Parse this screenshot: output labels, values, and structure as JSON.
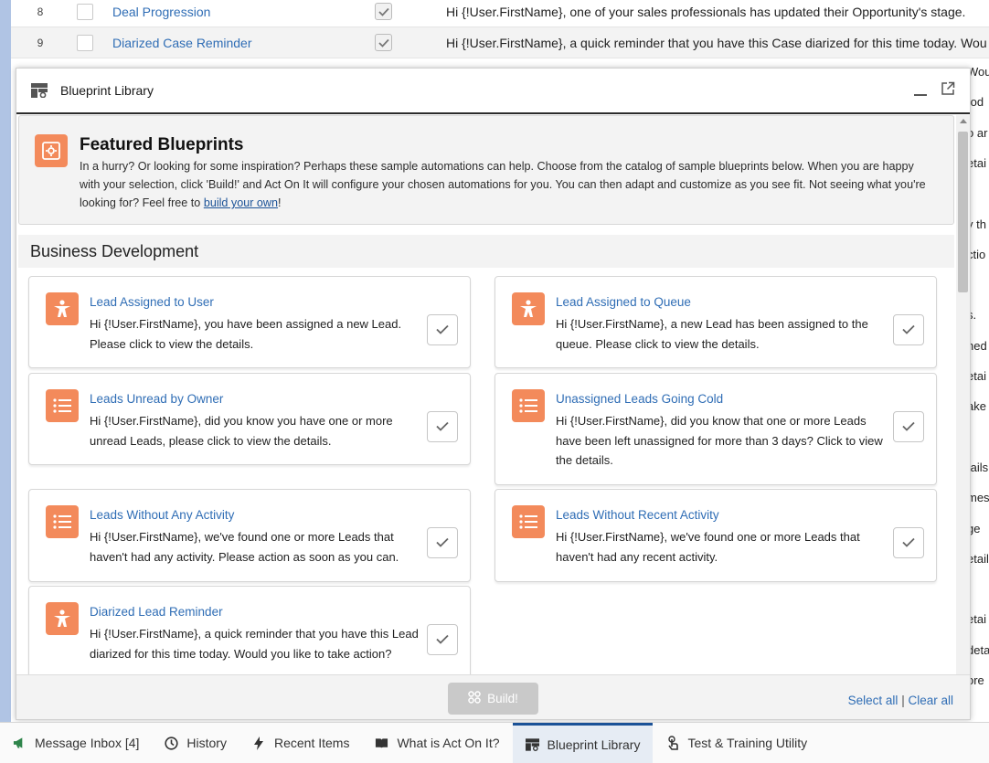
{
  "background_table": {
    "rows": [
      {
        "num": "8",
        "name": "Deal Progression",
        "message": "Hi {!User.FirstName}, one of your sales professionals has updated their Opportunity's stage."
      },
      {
        "num": "9",
        "name": "Diarized Case Reminder",
        "message": "Hi {!User.FirstName}, a quick reminder that you have this Case diarized for this time today. Wou"
      }
    ],
    "right_fragments": [
      "Wou",
      "tod",
      "o ar",
      "etai",
      "",
      "y th",
      "ctio",
      "",
      "s.",
      "ned",
      "etai",
      "ake",
      "",
      "tails",
      "mes",
      "ge",
      "etail",
      "",
      "etai",
      "deta",
      "ore"
    ]
  },
  "modal": {
    "title": "Blueprint Library",
    "featured": {
      "title": "Featured Blueprints",
      "description_before": "In a hurry? Or looking for some inspiration? Perhaps these sample automations can help. Choose from the catalog of sample blueprints below. When you are happy with your selection, click 'Build!' and Act On It will configure your chosen automations for you. You can then adapt and customize as you see fit. Not seeing what you're looking for? Feel free to ",
      "link_text": "build your own",
      "description_after": "!"
    },
    "section_title": "Business Development",
    "cards": [
      {
        "title": "Lead Assigned to User",
        "description": "Hi {!User.FirstName}, you have been assigned a new Lead. Please click to view the details.",
        "icon": "person-icon"
      },
      {
        "title": "Lead Assigned to Queue",
        "description": "Hi {!User.FirstName}, a new Lead has been assigned to the queue. Please click to view the details.",
        "icon": "person-icon"
      },
      {
        "title": "Leads Unread by Owner",
        "description": "Hi {!User.FirstName}, did you know you have one or more unread Leads, please click to view the details.",
        "icon": "list-icon"
      },
      {
        "title": "Unassigned Leads Going Cold",
        "description": "Hi {!User.FirstName}, did you know that one or more Leads have been left unassigned for more than 3 days? Click to view the details.",
        "icon": "list-icon"
      },
      {
        "title": "Leads Without Any Activity",
        "description": "Hi {!User.FirstName}, we've found one or more Leads that haven't had any activity. Please action as soon as you can.",
        "icon": "list-icon"
      },
      {
        "title": "Leads Without Recent Activity",
        "description": "Hi {!User.FirstName}, we've found one or more Leads that haven't had any recent activity.",
        "icon": "list-icon"
      },
      {
        "title": "Diarized Lead Reminder",
        "description": "Hi {!User.FirstName}, a quick reminder that you have this Lead diarized for this time today. Would you like to take action?",
        "icon": "person-icon"
      }
    ],
    "footer": {
      "build_label": "Build!",
      "select_all": "Select all",
      "separator": "|",
      "clear_all": "Clear all"
    }
  },
  "utility_bar": [
    {
      "label": "Message Inbox [4]",
      "icon": "megaphone-icon"
    },
    {
      "label": "History",
      "icon": "clock-icon"
    },
    {
      "label": "Recent Items",
      "icon": "bolt-icon"
    },
    {
      "label": "What is Act On It?",
      "icon": "book-icon"
    },
    {
      "label": "Blueprint Library",
      "icon": "blueprint-icon",
      "active": true
    },
    {
      "label": "Test & Training Utility",
      "icon": "touch-icon"
    }
  ],
  "colors": {
    "accent_orange": "#f38a5b",
    "link_blue": "#2f6db5",
    "active_border": "#1b5297"
  }
}
